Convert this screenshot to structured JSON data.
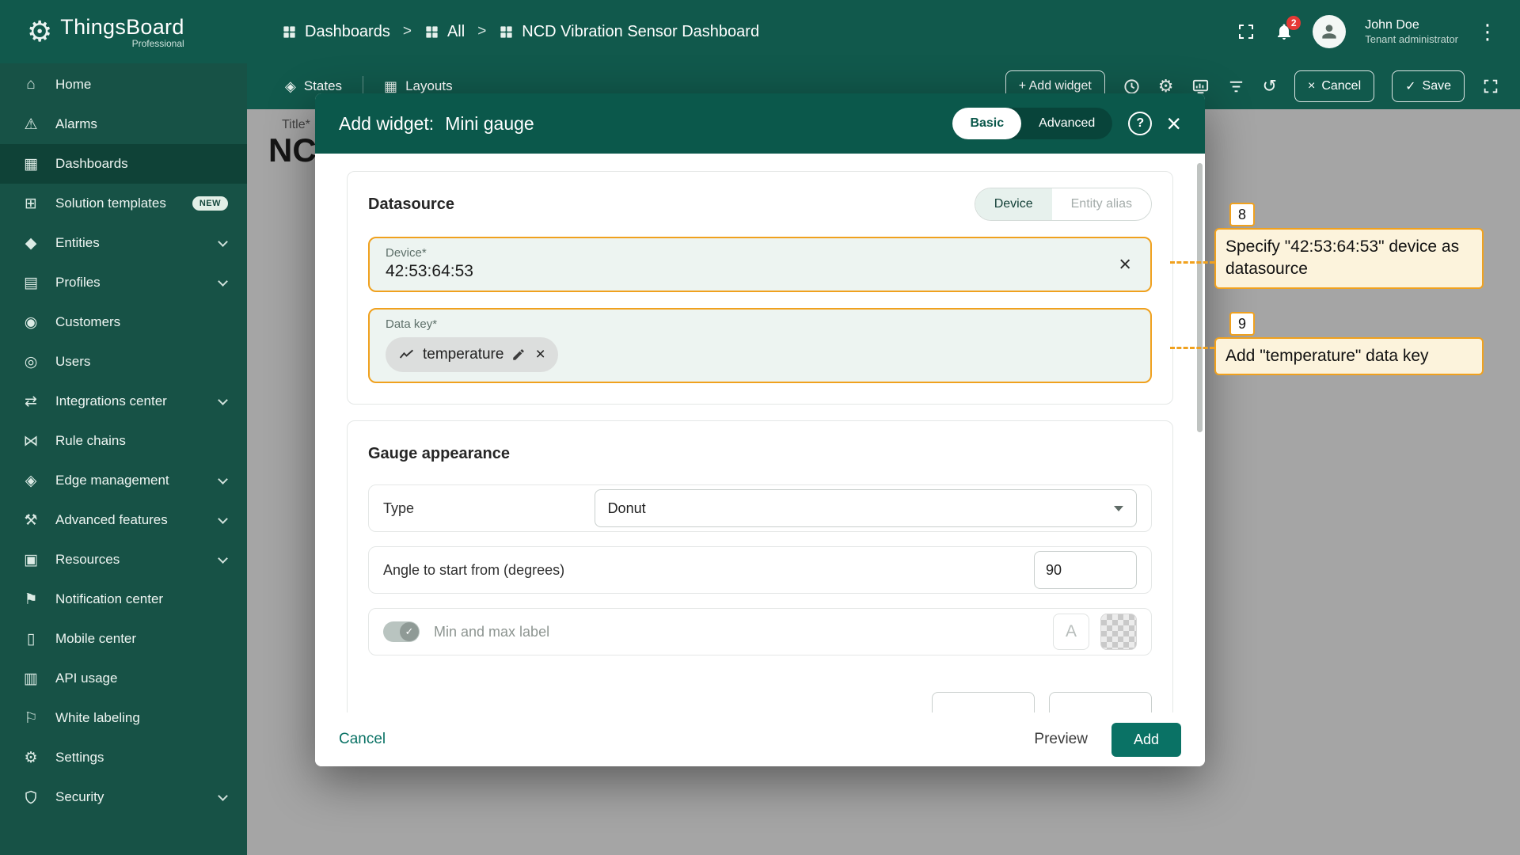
{
  "header": {
    "brand": "ThingsBoard",
    "brand_sub": "Professional",
    "breadcrumb": [
      "Dashboards",
      "All",
      "NCD Vibration Sensor Dashboard"
    ],
    "breadcrumb_separator": ">",
    "notification_count": "2",
    "user_name": "John Doe",
    "user_role": "Tenant administrator"
  },
  "toolbar": {
    "states": "States",
    "layouts": "Layouts",
    "add_widget": "+ Add widget",
    "cancel": "Cancel",
    "save": "Save"
  },
  "sidebar": [
    {
      "label": "Home",
      "icon": "home-icon"
    },
    {
      "label": "Alarms",
      "icon": "alarm-icon"
    },
    {
      "label": "Dashboards",
      "icon": "dashboards-icon",
      "active": true
    },
    {
      "label": "Solution templates",
      "icon": "templates-icon",
      "badge": "NEW"
    },
    {
      "label": "Entities",
      "icon": "entities-icon",
      "expandable": true
    },
    {
      "label": "Profiles",
      "icon": "profiles-icon",
      "expandable": true
    },
    {
      "label": "Customers",
      "icon": "customers-icon"
    },
    {
      "label": "Users",
      "icon": "users-icon"
    },
    {
      "label": "Integrations center",
      "icon": "integrations-icon",
      "expandable": true
    },
    {
      "label": "Rule chains",
      "icon": "rule-chains-icon"
    },
    {
      "label": "Edge management",
      "icon": "edge-icon",
      "expandable": true
    },
    {
      "label": "Advanced features",
      "icon": "advanced-icon",
      "expandable": true
    },
    {
      "label": "Resources",
      "icon": "resources-icon",
      "expandable": true
    },
    {
      "label": "Notification center",
      "icon": "notification-icon"
    },
    {
      "label": "Mobile center",
      "icon": "mobile-icon"
    },
    {
      "label": "API usage",
      "icon": "api-icon"
    },
    {
      "label": "White labeling",
      "icon": "white-label-icon"
    },
    {
      "label": "Settings",
      "icon": "settings-icon"
    },
    {
      "label": "Security",
      "icon": "security-icon",
      "expandable": true
    }
  ],
  "canvas": {
    "title_label": "Title*",
    "title_value": "NC"
  },
  "modal": {
    "title_prefix": "Add widget:",
    "title": "Mini gauge",
    "tabs": {
      "basic": "Basic",
      "advanced": "Advanced"
    },
    "help": "?",
    "datasource": {
      "section": "Datasource",
      "device_tab": "Device",
      "alias_tab": "Entity alias",
      "device_label": "Device*",
      "device_value": "42:53:64:53",
      "datakey_label": "Data key*",
      "chip_label": "temperature"
    },
    "appearance": {
      "section": "Gauge appearance",
      "type_label": "Type",
      "type_value": "Donut",
      "angle_label": "Angle to start from (degrees)",
      "angle_value": "90",
      "minmax_label": "Min and max label",
      "font_icon": "A"
    },
    "footer": {
      "cancel": "Cancel",
      "preview": "Preview",
      "add": "Add"
    }
  },
  "annotations": [
    {
      "number": "8",
      "text": "Specify \"42:53:64:53\" device as datasource"
    },
    {
      "number": "9",
      "text": "Add \"temperature\" data key"
    }
  ],
  "colors": {
    "header": "#11594c",
    "sidebar": "#175246",
    "modal_header": "#0b584b",
    "accent": "#0a7265",
    "annotation_orange": "#f0a11e",
    "badge_red": "#e53935"
  }
}
